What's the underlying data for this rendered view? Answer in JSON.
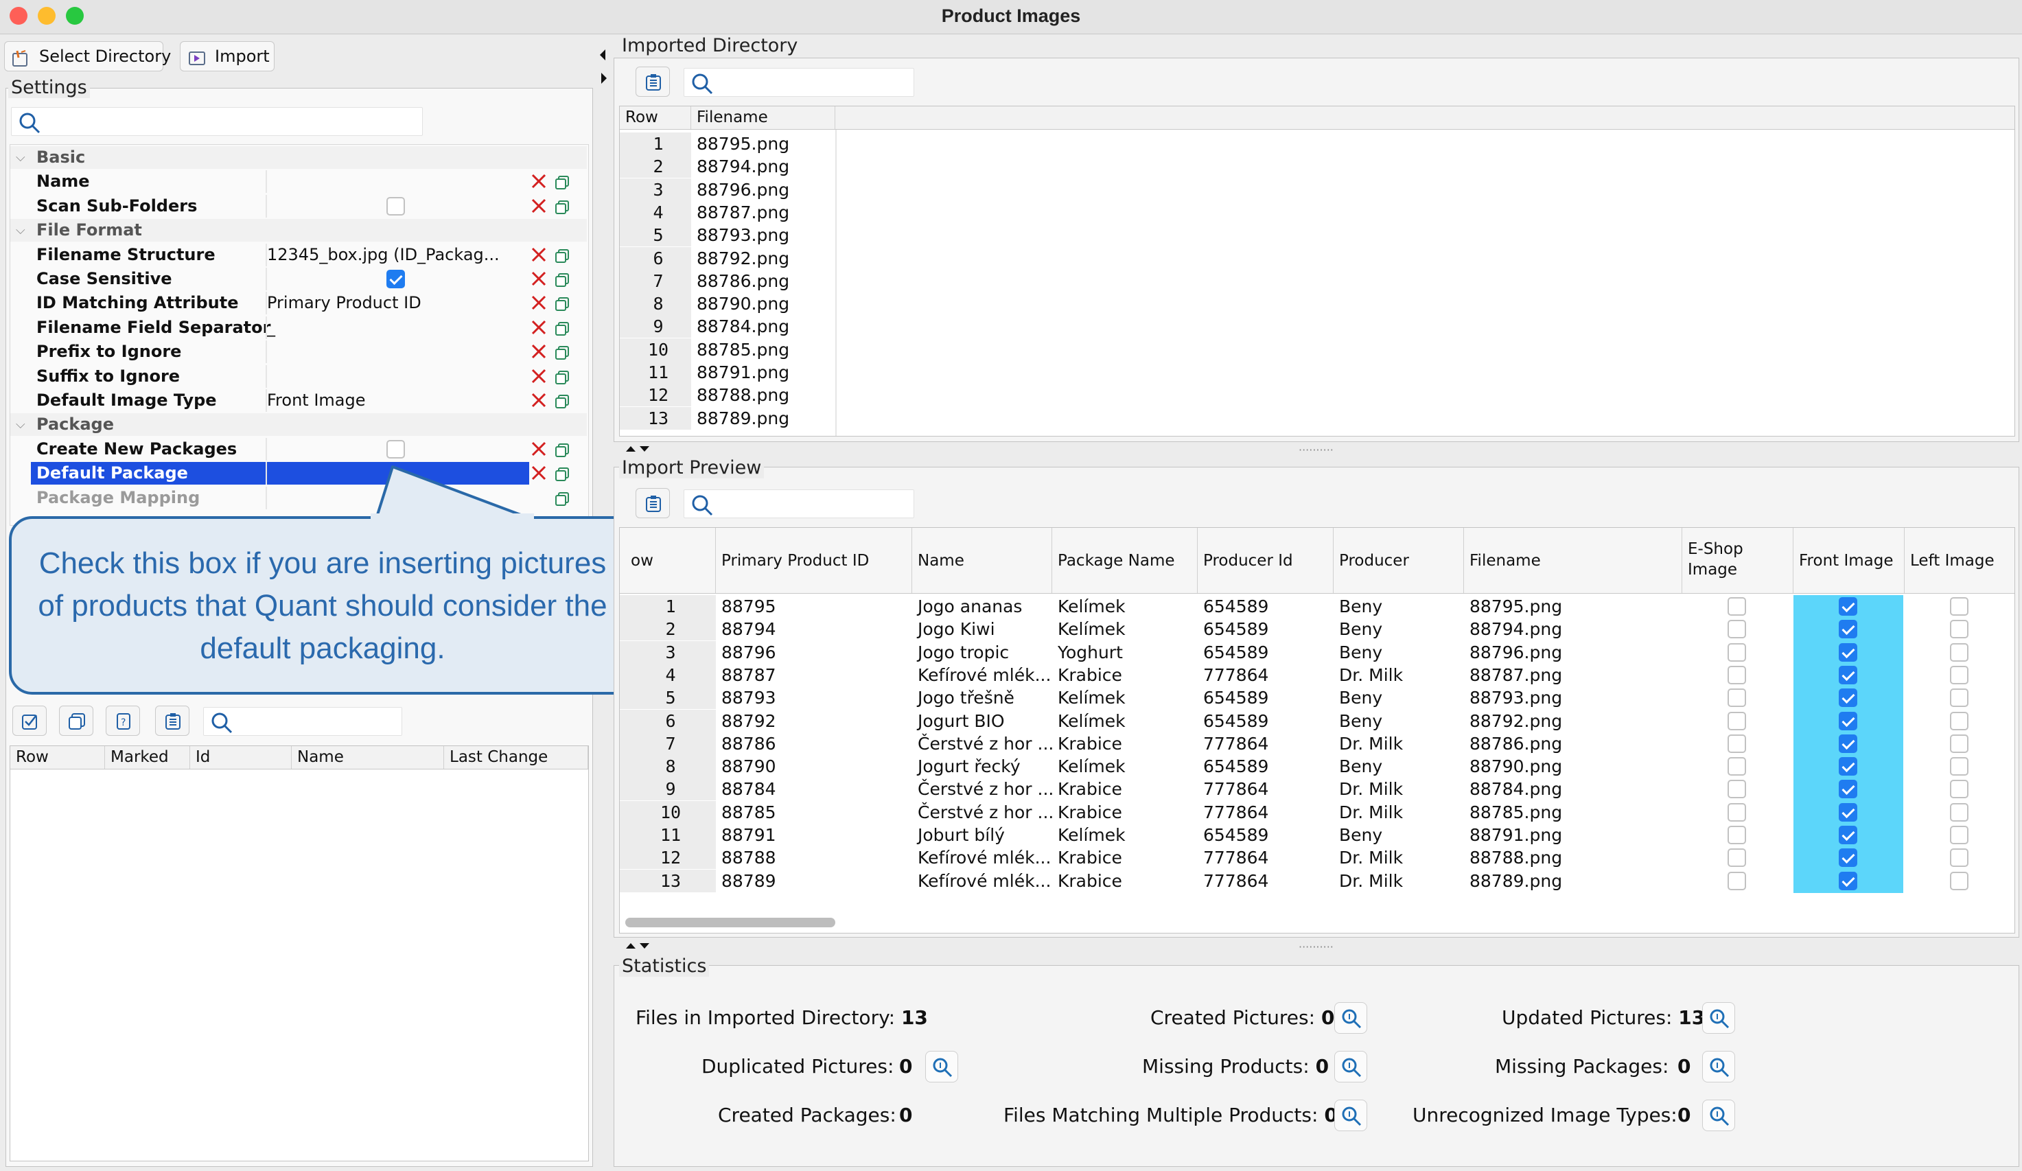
{
  "window": {
    "title": "Product Images"
  },
  "toolbar": {
    "select_directory": "Select Directory",
    "import": "Import"
  },
  "settings": {
    "title": "Settings",
    "rows": [
      {
        "type": "category",
        "name": "Basic"
      },
      {
        "type": "prop",
        "name": "Name",
        "value": ""
      },
      {
        "type": "prop",
        "name": "Scan Sub-Folders",
        "checkbox": false
      },
      {
        "type": "category",
        "name": "File Format"
      },
      {
        "type": "prop",
        "name": "Filename Structure",
        "value": "12345_box.jpg (ID_Packag..."
      },
      {
        "type": "prop",
        "name": "Case Sensitive",
        "checkbox": true
      },
      {
        "type": "prop",
        "name": "ID Matching Attribute",
        "value": "Primary Product ID"
      },
      {
        "type": "prop",
        "name": "Filename Field Separator",
        "value": "_"
      },
      {
        "type": "prop",
        "name": "Prefix to Ignore",
        "value": ""
      },
      {
        "type": "prop",
        "name": "Suffix to Ignore",
        "value": ""
      },
      {
        "type": "prop",
        "name": "Default Image Type",
        "value": "Front Image"
      },
      {
        "type": "category",
        "name": "Package"
      },
      {
        "type": "prop",
        "name": "Create New Packages",
        "checkbox": false
      },
      {
        "type": "prop",
        "name": "Default Package",
        "checkbox": true,
        "selected": true
      },
      {
        "type": "prop",
        "name": "Package Mapping",
        "value": "",
        "disabled": true
      }
    ]
  },
  "callout": {
    "text": "Check this box if you are inserting pictures of products that Quant should consider the default packaging."
  },
  "lower_left": {
    "columns": [
      "Row",
      "Marked",
      "Id",
      "Name",
      "Last Change"
    ]
  },
  "imported_directory": {
    "title": "Imported Directory",
    "columns": [
      "Row",
      "Filename"
    ],
    "rows": [
      [
        "1",
        "88795.png"
      ],
      [
        "2",
        "88794.png"
      ],
      [
        "3",
        "88796.png"
      ],
      [
        "4",
        "88787.png"
      ],
      [
        "5",
        "88793.png"
      ],
      [
        "6",
        "88792.png"
      ],
      [
        "7",
        "88786.png"
      ],
      [
        "8",
        "88790.png"
      ],
      [
        "9",
        "88784.png"
      ],
      [
        "10",
        "88785.png"
      ],
      [
        "11",
        "88791.png"
      ],
      [
        "12",
        "88788.png"
      ],
      [
        "13",
        "88789.png"
      ]
    ]
  },
  "import_preview": {
    "title": "Import Preview",
    "columns": [
      "ow",
      "Primary Product ID",
      "Name",
      "Package Name",
      "Producer Id",
      "Producer",
      "Filename",
      "E-Shop\nImage",
      "Front Image",
      "Left Image"
    ],
    "rows": [
      {
        "row": "1",
        "pid": "88795",
        "name": "Jogo ananas",
        "pkg": "Kelímek",
        "prodid": "654589",
        "producer": "Beny",
        "file": "88795.png",
        "eshop": false,
        "front": true,
        "left": false
      },
      {
        "row": "2",
        "pid": "88794",
        "name": "Jogo Kiwi",
        "pkg": "Kelímek",
        "prodid": "654589",
        "producer": "Beny",
        "file": "88794.png",
        "eshop": false,
        "front": true,
        "left": false
      },
      {
        "row": "3",
        "pid": "88796",
        "name": "Jogo tropic",
        "pkg": "Yoghurt",
        "prodid": "654589",
        "producer": "Beny",
        "file": "88796.png",
        "eshop": false,
        "front": true,
        "left": false
      },
      {
        "row": "4",
        "pid": "88787",
        "name": "Kefírové mlék...",
        "pkg": "Krabice",
        "prodid": "777864",
        "producer": "Dr. Milk",
        "file": "88787.png",
        "eshop": false,
        "front": true,
        "left": false
      },
      {
        "row": "5",
        "pid": "88793",
        "name": "Jogo třešně",
        "pkg": "Kelímek",
        "prodid": "654589",
        "producer": "Beny",
        "file": "88793.png",
        "eshop": false,
        "front": true,
        "left": false
      },
      {
        "row": "6",
        "pid": "88792",
        "name": "Jogurt BIO",
        "pkg": "Kelímek",
        "prodid": "654589",
        "producer": "Beny",
        "file": "88792.png",
        "eshop": false,
        "front": true,
        "left": false
      },
      {
        "row": "7",
        "pid": "88786",
        "name": "Čerstvé z hor ...",
        "pkg": "Krabice",
        "prodid": "777864",
        "producer": "Dr. Milk",
        "file": "88786.png",
        "eshop": false,
        "front": true,
        "left": false
      },
      {
        "row": "8",
        "pid": "88790",
        "name": "Jogurt řecký",
        "pkg": "Kelímek",
        "prodid": "654589",
        "producer": "Beny",
        "file": "88790.png",
        "eshop": false,
        "front": true,
        "left": false
      },
      {
        "row": "9",
        "pid": "88784",
        "name": "Čerstvé z hor ...",
        "pkg": "Krabice",
        "prodid": "777864",
        "producer": "Dr. Milk",
        "file": "88784.png",
        "eshop": false,
        "front": true,
        "left": false
      },
      {
        "row": "10",
        "pid": "88785",
        "name": "Čerstvé z hor ...",
        "pkg": "Krabice",
        "prodid": "777864",
        "producer": "Dr. Milk",
        "file": "88785.png",
        "eshop": false,
        "front": true,
        "left": false
      },
      {
        "row": "11",
        "pid": "88791",
        "name": "Joburt bílý",
        "pkg": "Kelímek",
        "prodid": "654589",
        "producer": "Beny",
        "file": "88791.png",
        "eshop": false,
        "front": true,
        "left": false
      },
      {
        "row": "12",
        "pid": "88788",
        "name": "Kefírové mlék...",
        "pkg": "Krabice",
        "prodid": "777864",
        "producer": "Dr. Milk",
        "file": "88788.png",
        "eshop": false,
        "front": true,
        "left": false
      },
      {
        "row": "13",
        "pid": "88789",
        "name": "Kefírové mlék...",
        "pkg": "Krabice",
        "prodid": "777864",
        "producer": "Dr. Milk",
        "file": "88789.png",
        "eshop": false,
        "front": true,
        "left": false
      }
    ]
  },
  "statistics": {
    "title": "Statistics",
    "files_label": "Files in Imported Directory:",
    "files_value": "13",
    "created_pictures_label": "Created Pictures:",
    "created_pictures_value": "0",
    "updated_pictures_label": "Updated Pictures:",
    "updated_pictures_value": "13",
    "duplicated_label": "Duplicated Pictures:",
    "duplicated_value": "0",
    "missing_products_label": "Missing Products:",
    "missing_products_value": "0",
    "missing_packages_label": "Missing Packages:",
    "missing_packages_value": "0",
    "created_packages_label": "Created Packages:",
    "created_packages_value": "0",
    "multi_label": "Files Matching Multiple Products:",
    "multi_value": "0",
    "unrecognized_label": "Unrecognized Image Types:",
    "unrecognized_value": "0"
  },
  "colors": {
    "selection": "#1d4fe0",
    "front_column": "#5cd6fa",
    "accent": "#1f7cf0",
    "callout_border": "#2a69a8"
  }
}
